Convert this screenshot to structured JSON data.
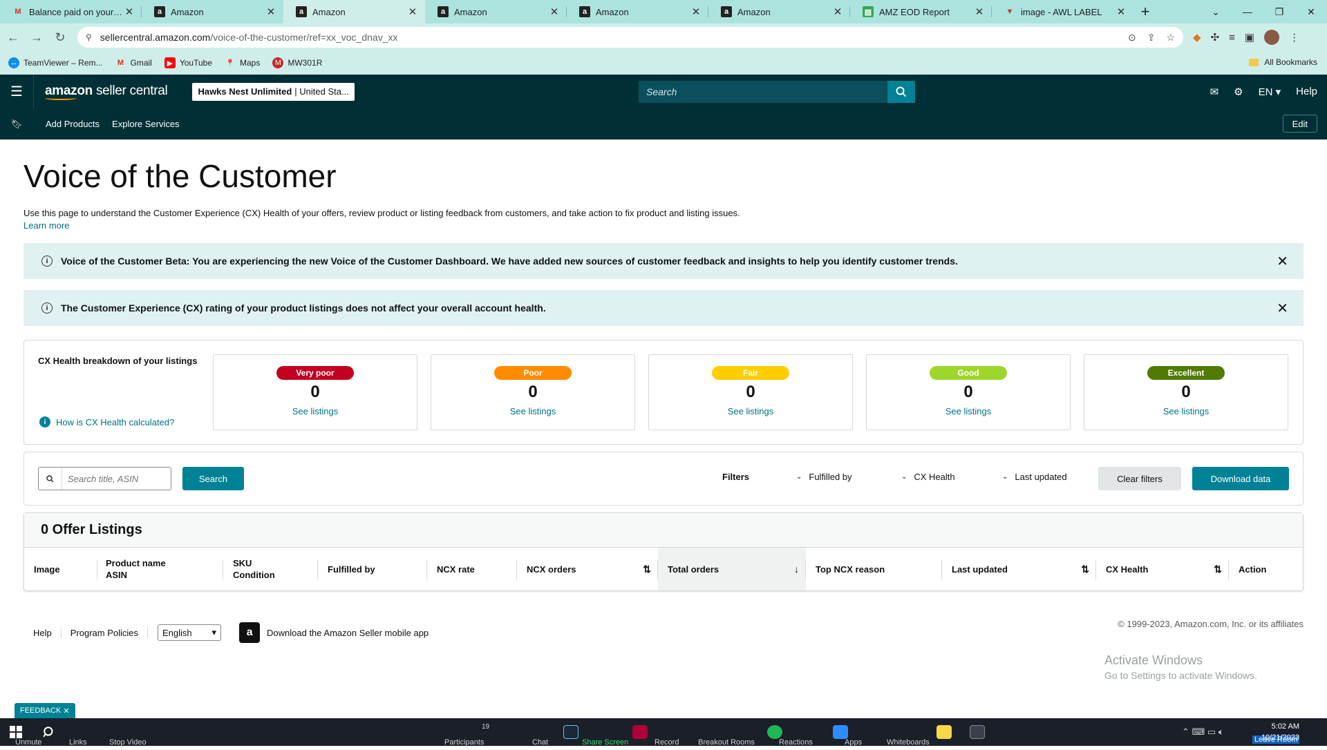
{
  "browser": {
    "tabs": [
      {
        "title": "Balance paid on your Ama",
        "favicon": "gmail-icon",
        "active": false
      },
      {
        "title": "Amazon",
        "favicon": "amazon-icon",
        "active": false
      },
      {
        "title": "Amazon",
        "favicon": "amazon-icon",
        "active": true
      },
      {
        "title": "Amazon",
        "favicon": "amazon-icon",
        "active": false
      },
      {
        "title": "Amazon",
        "favicon": "amazon-icon",
        "active": false
      },
      {
        "title": "Amazon",
        "favicon": "amazon-icon",
        "active": false
      },
      {
        "title": "AMZ EOD Report",
        "favicon": "sheets-icon",
        "active": false
      },
      {
        "title": "image - AWL LABEL",
        "favicon": "app-icon",
        "active": false
      }
    ],
    "url_host": "sellercentral.amazon.com",
    "url_path": "/voice-of-the-customer/ref=xx_voc_dnav_xx",
    "bookmarks": [
      {
        "label": "TeamViewer – Rem...",
        "icon": "teamviewer-icon"
      },
      {
        "label": "Gmail",
        "icon": "gmail-icon"
      },
      {
        "label": "YouTube",
        "icon": "youtube-icon"
      },
      {
        "label": "Maps",
        "icon": "maps-icon"
      },
      {
        "label": "MW301R",
        "icon": "mw-icon"
      }
    ],
    "all_bookmarks": "All Bookmarks"
  },
  "seller_header": {
    "logo_amazon": "amazon",
    "logo_sc": "seller central",
    "store_name": "Hawks Nest Unlimited",
    "store_market": "| United Sta...",
    "search_placeholder": "Search",
    "language": "EN",
    "help": "Help",
    "sub_links": [
      "Add Products",
      "Explore Services"
    ],
    "edit": "Edit"
  },
  "page": {
    "title": "Voice of the Customer",
    "intro": "Use this page to understand the Customer Experience (CX) Health of your offers, review product or listing feedback from customers, and take action to fix product and listing issues.",
    "learn_more": "Learn more",
    "banner1": "Voice of the Customer Beta: You are experiencing the new Voice of the Customer Dashboard. We have added new sources of customer feedback and insights to help you identify customer trends.",
    "banner2": "The Customer Experience (CX) rating of your product listings does not affect your overall account health."
  },
  "cx_health": {
    "title": "CX Health breakdown of your listings",
    "how_link": "How is CX Health calculated?",
    "see_listings": "See listings",
    "cards": [
      {
        "label": "Very poor",
        "count": "0",
        "color": "#c40022",
        "text": "#ffffff"
      },
      {
        "label": "Poor",
        "count": "0",
        "color": "#ff8c00",
        "text": "#ffffff"
      },
      {
        "label": "Fair",
        "count": "0",
        "color": "#ffcd00",
        "text": "#ffffff"
      },
      {
        "label": "Good",
        "count": "0",
        "color": "#9dd72c",
        "text": "#ffffff"
      },
      {
        "label": "Excellent",
        "count": "0",
        "color": "#507a00",
        "text": "#ffffff"
      }
    ]
  },
  "filters": {
    "search_placeholder": "Search title, ASIN",
    "search_button": "Search",
    "label": "Filters",
    "dropdowns": [
      "Fulfilled by",
      "CX Health",
      "Last updated"
    ],
    "clear": "Clear filters",
    "download": "Download data"
  },
  "listings_table": {
    "title": "0 Offer Listings",
    "columns": [
      {
        "line1": "Image",
        "line2": ""
      },
      {
        "line1": "Product name",
        "line2": "ASIN"
      },
      {
        "line1": "SKU",
        "line2": "Condition"
      },
      {
        "line1": "Fulfilled by",
        "line2": ""
      },
      {
        "line1": "NCX rate",
        "line2": ""
      },
      {
        "line1": "NCX orders",
        "line2": ""
      },
      {
        "line1": "Total orders",
        "line2": ""
      },
      {
        "line1": "Top NCX reason",
        "line2": ""
      },
      {
        "line1": "Last updated",
        "line2": ""
      },
      {
        "line1": "CX Health",
        "line2": ""
      },
      {
        "line1": "Action",
        "line2": ""
      }
    ]
  },
  "footer": {
    "links": [
      "Help",
      "Program Policies"
    ],
    "language": "English",
    "app_download": "Download the Amazon Seller mobile app",
    "copyright": "© 1999-2023, Amazon.com, Inc. or its affiliates"
  },
  "overlay": {
    "activate_title": "Activate Windows",
    "activate_sub": "Go to Settings to activate Windows.",
    "feedback": "FEEDBACK"
  },
  "taskbar": {
    "zoom_items": [
      "Unmute",
      "Stop Video",
      "Participants",
      "Chat",
      "Share Screen",
      "Record",
      "Breakout Rooms",
      "Reactions",
      "Apps",
      "Whiteboards",
      "Leave Room"
    ],
    "participants_count": "19",
    "time": "5:02 AM",
    "date": "10/21/2023",
    "links_label": "Links"
  }
}
